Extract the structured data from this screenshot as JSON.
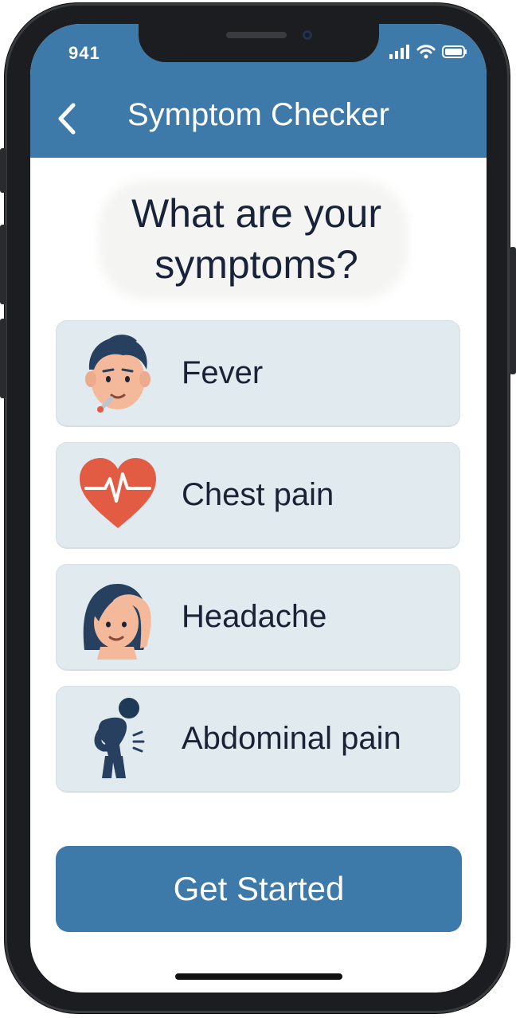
{
  "status": {
    "time": "941"
  },
  "header": {
    "title": "Symptom Checker",
    "back_icon": "chevron-left-icon"
  },
  "question": {
    "line1": "What are your",
    "line2": "symptoms?"
  },
  "symptoms": [
    {
      "label": "Fever",
      "icon": "fever-face-icon"
    },
    {
      "label": "Chest pain",
      "icon": "heart-pulse-icon"
    },
    {
      "label": "Headache",
      "icon": "headache-woman-icon"
    },
    {
      "label": "Abdominal pain",
      "icon": "abdominal-pain-person-icon"
    }
  ],
  "cta": {
    "label": "Get Started"
  },
  "colors": {
    "accent": "#3d7aa9",
    "card": "#e1eaee",
    "text": "#1c2236"
  }
}
